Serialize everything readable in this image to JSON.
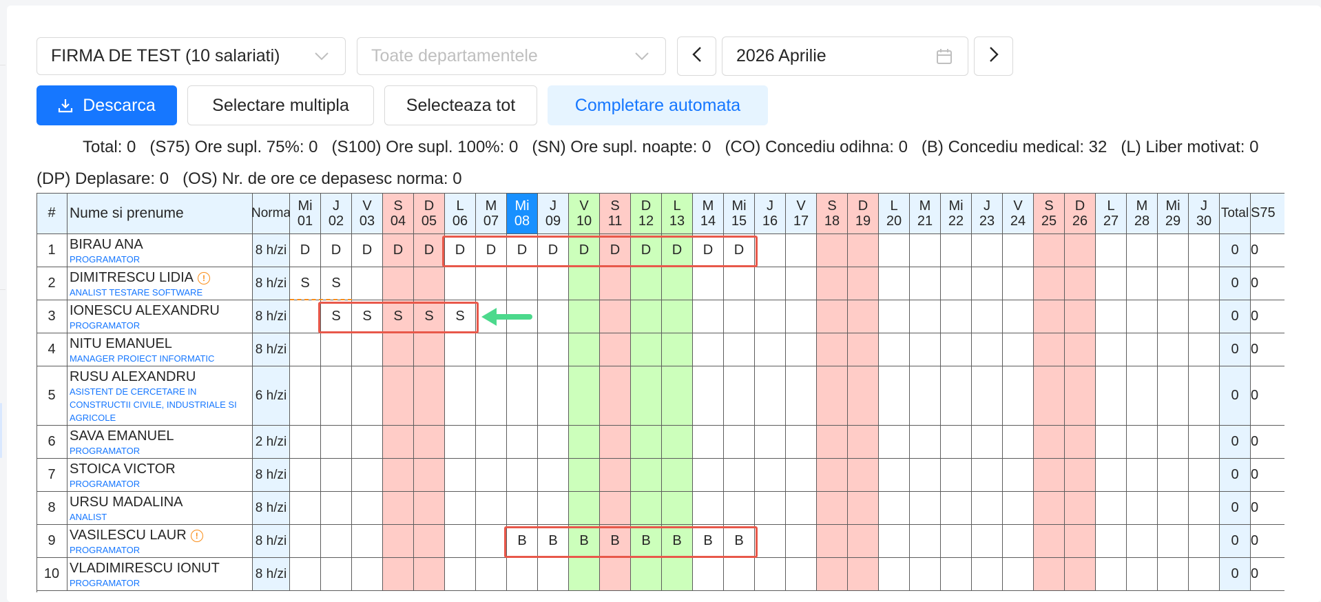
{
  "toolbar": {
    "company": "FIRMA DE TEST (10 salariati)",
    "department_placeholder": "Toate departamentele",
    "month": "2026 Aprilie",
    "download_label": "Descarca",
    "multi_select_label": "Selectare multipla",
    "select_all_label": "Selecteaza tot",
    "autofill_label": "Completare automata"
  },
  "summary": {
    "line1": "Total: 0   (S75) Ore supl. 75%: 0   (S100) Ore supl. 100%: 0   (SN) Ore supl. noapte: 0   (CO) Concediu odihna: 0   (B) Concediu medical: 32   (L) Liber motivat: 0",
    "line2": "(DP) Deplasare: 0   (OS) Nr. de ore ce depasesc norma: 0"
  },
  "table": {
    "headers": {
      "index": "#",
      "name": "Nume si prenume",
      "norm": "Norma",
      "total": "Total",
      "s75": "S75"
    },
    "days": [
      {
        "d": "Mi",
        "n": "01",
        "t": "w"
      },
      {
        "d": "J",
        "n": "02",
        "t": "w"
      },
      {
        "d": "V",
        "n": "03",
        "t": "w"
      },
      {
        "d": "S",
        "n": "04",
        "t": "we"
      },
      {
        "d": "D",
        "n": "05",
        "t": "we"
      },
      {
        "d": "L",
        "n": "06",
        "t": "w"
      },
      {
        "d": "M",
        "n": "07",
        "t": "w"
      },
      {
        "d": "Mi",
        "n": "08",
        "t": "today"
      },
      {
        "d": "J",
        "n": "09",
        "t": "w"
      },
      {
        "d": "V",
        "n": "10",
        "t": "hol"
      },
      {
        "d": "S",
        "n": "11",
        "t": "we"
      },
      {
        "d": "D",
        "n": "12",
        "t": "hol"
      },
      {
        "d": "L",
        "n": "13",
        "t": "hol"
      },
      {
        "d": "M",
        "n": "14",
        "t": "w"
      },
      {
        "d": "Mi",
        "n": "15",
        "t": "w"
      },
      {
        "d": "J",
        "n": "16",
        "t": "w"
      },
      {
        "d": "V",
        "n": "17",
        "t": "w"
      },
      {
        "d": "S",
        "n": "18",
        "t": "we"
      },
      {
        "d": "D",
        "n": "19",
        "t": "we"
      },
      {
        "d": "L",
        "n": "20",
        "t": "w"
      },
      {
        "d": "M",
        "n": "21",
        "t": "w"
      },
      {
        "d": "Mi",
        "n": "22",
        "t": "w"
      },
      {
        "d": "J",
        "n": "23",
        "t": "w"
      },
      {
        "d": "V",
        "n": "24",
        "t": "w"
      },
      {
        "d": "S",
        "n": "25",
        "t": "we"
      },
      {
        "d": "D",
        "n": "26",
        "t": "we"
      },
      {
        "d": "L",
        "n": "27",
        "t": "w"
      },
      {
        "d": "M",
        "n": "28",
        "t": "w"
      },
      {
        "d": "Mi",
        "n": "29",
        "t": "w"
      },
      {
        "d": "J",
        "n": "30",
        "t": "w"
      }
    ],
    "rows": [
      {
        "idx": "1",
        "name": "BIRAU ANA",
        "role": "PROGRAMATOR",
        "norm": "8 h/zi",
        "warn": false,
        "cells": {
          "01": "D",
          "02": "D",
          "03": "D",
          "04": "D",
          "05": "D",
          "06": "D",
          "07": "D",
          "08": "D",
          "09": "D",
          "10": "D",
          "11": "D",
          "12": "D",
          "13": "D",
          "14": "D",
          "15": "D"
        },
        "total": "0",
        "s75": "0"
      },
      {
        "idx": "2",
        "name": "DIMITRESCU LIDIA",
        "role": "ANALIST TESTARE SOFTWARE",
        "norm": "8 h/zi",
        "warn": true,
        "cells": {
          "01": "S",
          "02": "S"
        },
        "total": "0",
        "s75": "0"
      },
      {
        "idx": "3",
        "name": "IONESCU ALEXANDRU",
        "role": "PROGRAMATOR",
        "norm": "8 h/zi",
        "warn": false,
        "cells": {
          "02": "S",
          "03": "S",
          "04": "S",
          "05": "S",
          "06": "S"
        },
        "total": "0",
        "s75": "0"
      },
      {
        "idx": "4",
        "name": "NITU EMANUEL",
        "role": "MANAGER PROIECT INFORMATIC",
        "norm": "8 h/zi",
        "warn": false,
        "cells": {},
        "total": "0",
        "s75": "0"
      },
      {
        "idx": "5",
        "name": "RUSU ALEXANDRU",
        "role": "ASISTENT DE CERCETARE IN CONSTRUCTII CIVILE, INDUSTRIALE SI AGRICOLE",
        "norm": "6 h/zi",
        "warn": false,
        "cells": {},
        "total": "0",
        "s75": "0",
        "tall": true
      },
      {
        "idx": "6",
        "name": "SAVA EMANUEL",
        "role": "PROGRAMATOR",
        "norm": "2 h/zi",
        "warn": false,
        "cells": {},
        "total": "0",
        "s75": "0"
      },
      {
        "idx": "7",
        "name": "STOICA VICTOR",
        "role": "PROGRAMATOR",
        "norm": "8 h/zi",
        "warn": false,
        "cells": {},
        "total": "0",
        "s75": "0"
      },
      {
        "idx": "8",
        "name": "URSU MADALINA",
        "role": "ANALIST",
        "norm": "8 h/zi",
        "warn": false,
        "cells": {},
        "total": "0",
        "s75": "0"
      },
      {
        "idx": "9",
        "name": "VASILESCU LAUR",
        "role": "PROGRAMATOR",
        "norm": "8 h/zi",
        "warn": true,
        "cells": {
          "08": "B",
          "09": "B",
          "10": "B",
          "11": "B",
          "12": "B",
          "13": "B",
          "14": "B",
          "15": "B"
        },
        "total": "0",
        "s75": "0"
      },
      {
        "idx": "10",
        "name": "VLADIMIRESCU IONUT",
        "role": "PROGRAMATOR",
        "norm": "8 h/zi",
        "warn": false,
        "cells": {},
        "total": "0",
        "s75": "0"
      }
    ]
  },
  "colors": {
    "primary": "#1677ff",
    "weekend": "#ffccc7",
    "holiday": "#ccffbb",
    "header": "#e6f4ff",
    "today": "#1890ff",
    "highlight": "#e8584a",
    "arrow": "#4cd98c",
    "warning": "#fa8c16"
  },
  "icons": {
    "dropdown": "chevron-down-icon",
    "calendar": "calendar-icon",
    "prev": "chevron-left-icon",
    "next": "chevron-right-icon",
    "download": "download-icon",
    "warning": "exclamation-circle-icon"
  }
}
